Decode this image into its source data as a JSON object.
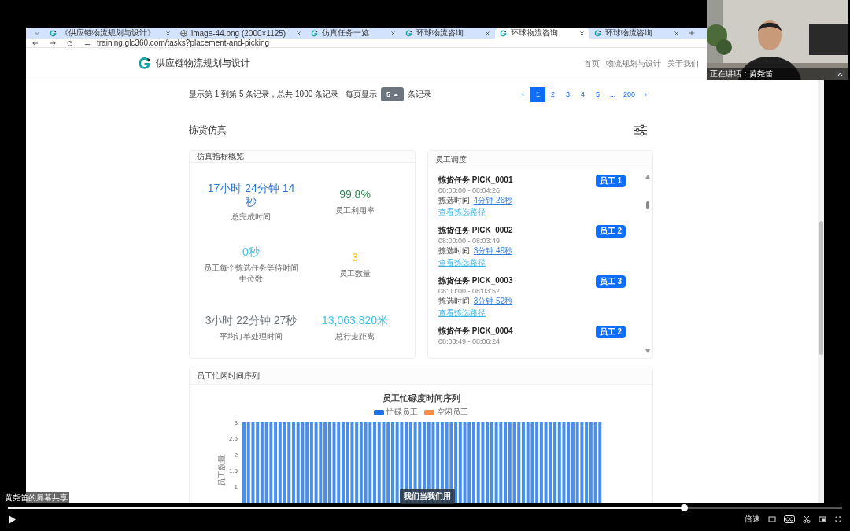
{
  "browser": {
    "tabs": [
      {
        "title": "《供应链物流规划与设计》",
        "kind": "site",
        "selected": false
      },
      {
        "title": "image-44.png (2000×1125)",
        "selected": false
      },
      {
        "title": "仿真任务一览",
        "kind": "site",
        "selected": false
      },
      {
        "title": "环球物流咨询",
        "kind": "site",
        "selected": false
      },
      {
        "title": "环球物流咨询",
        "kind": "site",
        "selected": true
      },
      {
        "title": "环球物流咨询",
        "kind": "site",
        "selected": false
      }
    ],
    "url": "training.glc360.com/tasks?placement-and-picking"
  },
  "header": {
    "brand": "供应链物流规划与设计",
    "nav": [
      "首页",
      "物流规划与设计",
      "关于我们"
    ]
  },
  "pagination": {
    "summary": "显示第 1 到第 5 条记录，总共 1000 条记录",
    "per_page_label": "每页显示",
    "per_page": "5",
    "per_page_suffix": "条记录",
    "prev": "‹",
    "next": "›",
    "pages": [
      {
        "label": "1",
        "selected": true
      },
      {
        "label": "2",
        "selected": false
      },
      {
        "label": "3",
        "selected": false
      },
      {
        "label": "4",
        "selected": false
      },
      {
        "label": "5",
        "selected": false
      },
      {
        "label": "...",
        "selected": false
      },
      {
        "label": "200",
        "selected": false
      }
    ]
  },
  "section_title": "拣货仿真",
  "overview": {
    "title": "仿真指标概览",
    "metrics": [
      {
        "value": "17小时 24分钟 14秒",
        "label": "总完成时间",
        "color": "#2f7bd8"
      },
      {
        "value": "99.8%",
        "label": "员工利用率",
        "color": "#2e8b57"
      },
      {
        "value": "0秒",
        "label": "员工每个拣选任务等待时间中位数",
        "color": "#3cc0e8"
      },
      {
        "value": "3",
        "label": "员工数量",
        "color": "#f5c518"
      },
      {
        "value": "3小时 22分钟 27秒",
        "label": "平均订单处理时间",
        "color": "#6c757d"
      },
      {
        "value": "13,063,820米",
        "label": "总行走距离",
        "color": "#3cc0e8"
      }
    ]
  },
  "schedule": {
    "title": "员工调度",
    "tasks": [
      {
        "title": "拣货任务 PICK_0001",
        "time": "08:00:00 - 08:04:26",
        "duration_label": "拣选时间:",
        "duration": "4分钟 26秒",
        "link": "查看拣选路径",
        "worker": "员工 1"
      },
      {
        "title": "拣货任务 PICK_0002",
        "time": "08:00:00 - 08:03:49",
        "duration_label": "拣选时间:",
        "duration": "3分钟 49秒",
        "link": "查看拣选路径",
        "worker": "员工 2"
      },
      {
        "title": "拣货任务 PICK_0003",
        "time": "08:00:00 - 08:03:52",
        "duration_label": "拣选时间:",
        "duration": "3分钟 52秒",
        "link": "查看拣选路径",
        "worker": "员工 3"
      },
      {
        "title": "拣货任务 PICK_0004",
        "time": "08:03:49 - 08:06:24",
        "worker": "员工 2"
      }
    ]
  },
  "timeline": {
    "title": "员工忙闲时间序列",
    "chart_data": {
      "type": "bar",
      "title": "员工忙碌度时间序列",
      "ylabel": "员工数量",
      "stacked": true,
      "ylim": [
        0,
        3
      ],
      "yticks": [
        1,
        1.5,
        2,
        2.5,
        3
      ],
      "series": [
        {
          "name": "忙碌员工",
          "color": "#1a73e8",
          "values": [
            3,
            3,
            3,
            3,
            3,
            3,
            3,
            3,
            3,
            3,
            3,
            3,
            3,
            3,
            3,
            3,
            3,
            3,
            3,
            3,
            3,
            3,
            3,
            3,
            3,
            3,
            3,
            3,
            3,
            3,
            3,
            3,
            3,
            3,
            3,
            3,
            3,
            3,
            3,
            3,
            3,
            3,
            3,
            3,
            3,
            3,
            3,
            3,
            3,
            3,
            3,
            3,
            3,
            3,
            3,
            3,
            3,
            3,
            3,
            3,
            3,
            3,
            3,
            3,
            3,
            3,
            3,
            3,
            3,
            3,
            3,
            3,
            3,
            3,
            3,
            3,
            3,
            3,
            3,
            3
          ]
        },
        {
          "name": "空闲员工",
          "color": "#ff8c42",
          "values": [
            0,
            0,
            0,
            0,
            0,
            0,
            0,
            0,
            0,
            0,
            0,
            0,
            0,
            0,
            0,
            0,
            0,
            0,
            0,
            0,
            0,
            0,
            0,
            0,
            0,
            0,
            0,
            0,
            0,
            0,
            0,
            0,
            0,
            0,
            0,
            0,
            0,
            0,
            0,
            0,
            0,
            0,
            0,
            0,
            0,
            0,
            0,
            0,
            0,
            0,
            0,
            0,
            0,
            0,
            0,
            0,
            0,
            0,
            0,
            0,
            0,
            0,
            0,
            0,
            0,
            0,
            0,
            0,
            0,
            0,
            0,
            0,
            0,
            0,
            0,
            0,
            0,
            0,
            0,
            0
          ]
        }
      ]
    }
  },
  "meeting": {
    "speaking": "正在讲话：黄尧笛",
    "share_label": "黄尧笛的屏幕共享",
    "subtitle": "我们当我们用"
  },
  "player": {
    "level": 0.81,
    "speed": "倍速"
  }
}
